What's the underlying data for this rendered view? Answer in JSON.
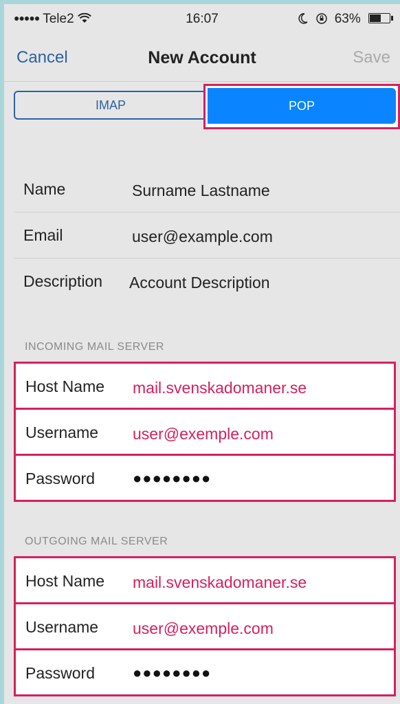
{
  "status_bar": {
    "carrier": "Tele2",
    "signal_dots": "●●●●●",
    "wifi_icon": "wifi-icon",
    "time": "16:07",
    "moon_icon": "moon-icon",
    "lock_icon": "orientation-lock-icon",
    "battery_percent": "63%",
    "battery_level": 0.63
  },
  "nav": {
    "cancel": "Cancel",
    "title": "New Account",
    "save": "Save"
  },
  "segment": {
    "options": [
      "IMAP",
      "POP"
    ],
    "selected": "POP"
  },
  "account": {
    "name_label": "Name",
    "name_value": "Surname Lastname",
    "email_label": "Email",
    "email_value": "user@example.com",
    "description_label": "Description",
    "description_value": "Account Description"
  },
  "incoming": {
    "header": "INCOMING MAIL SERVER",
    "host_label": "Host Name",
    "host_value": "mail.svenskadomaner.se",
    "username_label": "Username",
    "username_value": "user@exemple.com",
    "password_label": "Password",
    "password_value": "●●●●●●●●"
  },
  "outgoing": {
    "header": "OUTGOING MAIL SERVER",
    "host_label": "Host Name",
    "host_value": "mail.svenskadomaner.se",
    "username_label": "Username",
    "username_value": "user@exemple.com",
    "password_label": "Password",
    "password_value": "●●●●●●●●"
  },
  "colors": {
    "accent": "#2b62a3",
    "selected_segment": "#0a84ff",
    "highlight": "#d6205c"
  }
}
